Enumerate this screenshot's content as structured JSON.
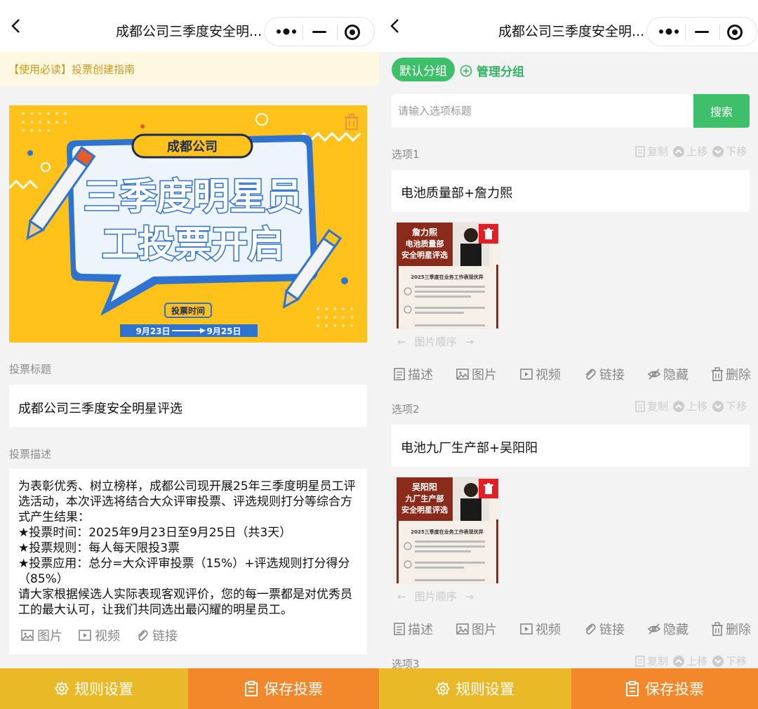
{
  "left": {
    "nav_title": "成都公司三季度安全明...",
    "notice": "【使用必读】投票创建指南",
    "banner": {
      "company": "成都公司",
      "headline_line1": "三季度明星员",
      "headline_line2": "工投票开启",
      "time_label": "投票时间",
      "start": "9月23日",
      "end": "9月25日"
    },
    "title_label": "投票标题",
    "title_value": "成都公司三季度安全明星评选",
    "desc_label": "投票描述",
    "desc_value": "为表彰优秀、树立榜样，成都公司现开展25年三季度明星员工评选活动，本次评选将结合大众评审投票、评选规则打分等综合方式产生结果：\n★投票时间：2025年9月23日至9月25日（共3天）\n★投票规则：每人每天限投3票\n★投票应用：总分=大众评审投票（15%）+评选规则打分得分（85%）\n请大家根据候选人实际表现客观评价，您的每一票都是对优秀员工的最大认可，让我们共同选出最闪耀的明星员工。",
    "media": {
      "image": "图片",
      "video": "视频",
      "link": "链接"
    },
    "rule_button": "规则设置",
    "save_button": "保存投票"
  },
  "right": {
    "nav_title": "成都公司三季度安全明...",
    "group_default": "默认分组",
    "group_manage": "管理分组",
    "search_placeholder": "请输入选项标题",
    "search_button": "搜索",
    "tools": {
      "copy": "复制",
      "up": "上移",
      "down": "下移"
    },
    "order_label": "图片顺序",
    "actions": {
      "desc": "描述",
      "image": "图片",
      "video": "视频",
      "link": "链接",
      "hide": "隐藏",
      "delete": "删除"
    },
    "options": [
      {
        "label": "选项1",
        "title": "电池质量部+詹力熙",
        "photo_name": "詹力熙",
        "photo_dept": "电池质量部",
        "photo_sub": "安全明星评选",
        "photo_heading": "2025三季度在业务工作表现优异"
      },
      {
        "label": "选项2",
        "title": "电池九厂生产部+吴阳阳",
        "photo_name": "吴阳阳",
        "photo_dept": "九厂生产部",
        "photo_sub": "安全明星评选",
        "photo_heading": "2025三季度在业务工作表现优异"
      },
      {
        "label": "选项3"
      }
    ],
    "rule_button": "规则设置",
    "save_button": "保存投票"
  },
  "colors": {
    "green": "#3ec06a",
    "yellow": "#e9b928",
    "orange": "#f2882b",
    "banner_bg": "#ffc21a",
    "red": "#e41e26"
  }
}
